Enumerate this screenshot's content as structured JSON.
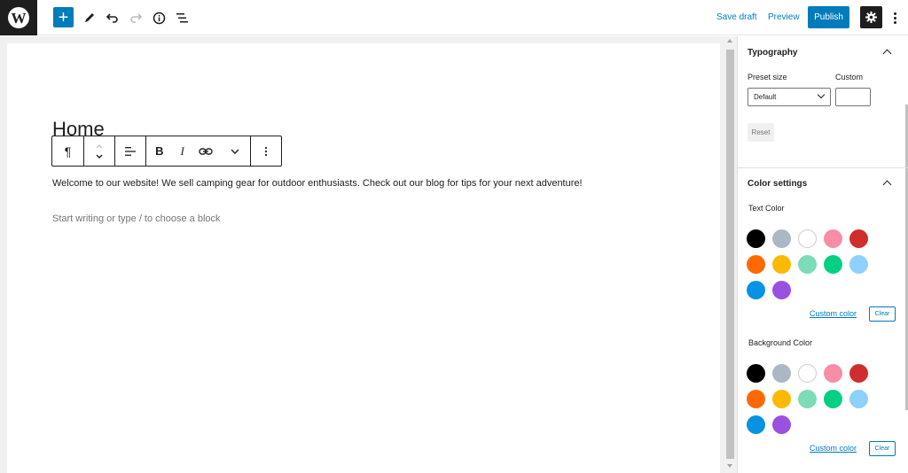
{
  "topbar": {
    "logo_letter": "W",
    "add_icon": "plus-icon",
    "tools_icon": "pencil-icon",
    "undo_icon": "undo-icon",
    "redo_icon": "redo-icon",
    "info_icon": "info-icon",
    "outline_icon": "list-view-icon",
    "save_draft": "Save draft",
    "preview": "Preview",
    "publish": "Publish",
    "settings_icon": "gear-icon",
    "more_icon": "kebab-icon"
  },
  "editor": {
    "title": "Home",
    "toolbar": {
      "paragraph_glyph": "¶",
      "bold": "B",
      "italic": "I"
    },
    "paragraph": "Welcome to our website! We sell camping gear for outdoor enthusiasts. Check out our blog for tips for your next adventure!",
    "placeholder": "Start writing or type / to choose a block"
  },
  "sidebar": {
    "typography": {
      "title": "Typography",
      "preset_label": "Preset size",
      "custom_label": "Custom",
      "preset_value": "Default",
      "reset": "Reset"
    },
    "color_settings": {
      "title": "Color settings",
      "text_color_label": "Text Color",
      "background_color_label": "Background Color",
      "custom_color": "Custom color",
      "clear": "Clear",
      "palette": [
        "#000000",
        "#abb8c3",
        "#ffffff",
        "#f78da7",
        "#cf2e2e",
        "#ff6900",
        "#fcb900",
        "#7bdcb5",
        "#00d084",
        "#8ed1fc",
        "#0693e3",
        "#9b51e0"
      ]
    }
  },
  "colors": {
    "accent": "#007cba",
    "dark": "#1e1e1e"
  }
}
